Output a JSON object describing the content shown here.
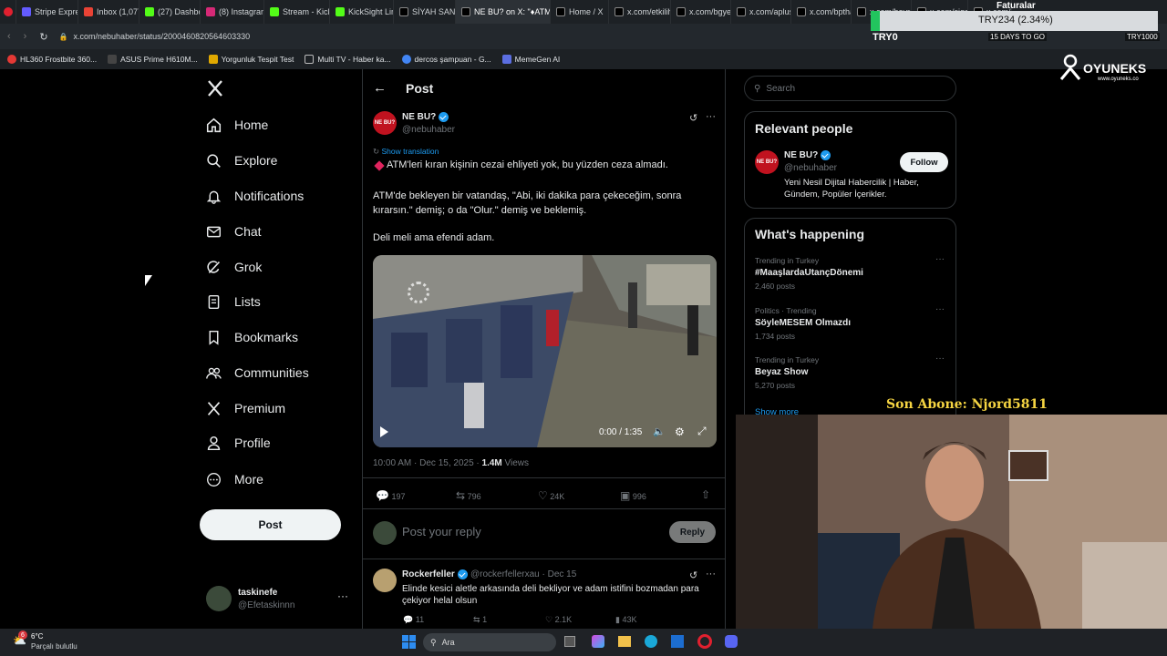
{
  "browser": {
    "tabs": [
      "Stripe Express",
      "Inbox (1,077)",
      "(27) Dashbo",
      "(8) Instagram",
      "Stream - Kick",
      "KickSight Link",
      "SİYAH SANCA",
      "NE BU? on X: \"♦ATM",
      "Home / X",
      "x.com/etkilih",
      "x.com/bgyeti",
      "x.com/aplusr",
      "x.com/bpthal",
      "x.com/hayra",
      "x.com/sigas",
      "x.com/ibrahi"
    ],
    "url": "x.com/nebuhaber/status/2000460820564603330",
    "bookmarks": [
      "HL360 Frostbite 360...",
      "ASUS Prime H610M...",
      "Yorgunluk Tespit Test",
      "Multi TV - Haber ka...",
      "dercos şampuan - G...",
      "MemeGen AI"
    ]
  },
  "overlay": {
    "faturalar": "Faturalar",
    "price": "TRY234 (2.34%)",
    "try0": "TRY0",
    "days_to_go": "15 DAYS TO GO",
    "try_small": "TRY1000",
    "brand": "OYUNEKS",
    "brand_url": "www.oyuneks.co",
    "subscriber": "Son Abone: Njord5811"
  },
  "nav": {
    "items": [
      "Home",
      "Explore",
      "Notifications",
      "Chat",
      "Grok",
      "Lists",
      "Bookmarks",
      "Communities",
      "Premium",
      "Profile",
      "More"
    ],
    "post_button": "Post",
    "account_name": "taskinefe",
    "account_handle": "@Efetaskinnn",
    "more_dots": "···"
  },
  "post": {
    "header_title": "Post",
    "author_name": "NE BU?",
    "author_handle": "@nebuhaber",
    "avatar_text": "NE BU?",
    "show_translation": "Show translation",
    "line1": "ATM'leri kıran kişinin cezai ehliyeti yok, bu yüzden ceza almadı.",
    "line2": "ATM'de bekleyen bir vatandaş, \"Abi, iki dakika para çekeceğim, sonra kırarsın.\" demiş; o da \"Olur.\" demiş ve beklemiş.",
    "line3": "Deli meli ama efendi adam.",
    "video_time": "0:00 / 1:35",
    "timestamp": "10:00 AM · Dec 15, 2025 · ",
    "views_count": "1.4M",
    "views_label": " Views",
    "replies": "197",
    "reposts": "796",
    "likes": "24K",
    "bookmarks": "996",
    "reply_placeholder": "Post your reply",
    "reply_button": "Reply"
  },
  "reply": {
    "name": "Rockerfeller",
    "meta": "@rockerfellerxau · Dec 15",
    "text": "Elinde kesici aletle arkasında deli bekliyor ve adam istifini bozmadan para çekiyor helal olsun",
    "replies": "11",
    "reposts": "1",
    "likes": "2.1K",
    "views": "43K"
  },
  "sidebar": {
    "search_placeholder": "Search",
    "relevant_title": "Relevant people",
    "person_name": "NE BU?",
    "person_handle": "@nebuhaber",
    "person_bio": "Yeni Nesil Dijital Habercilik | Haber, Gündem, Popüler İçerikler.",
    "follow_button": "Follow",
    "happening_title": "What's happening",
    "trends": [
      {
        "context": "Trending in Turkey",
        "name": "#MaaşlardaUtançDönemi",
        "posts": "2,460 posts"
      },
      {
        "context": "Politics · Trending",
        "name": "SöyleMESEM Olmazdı",
        "posts": "1,734 posts"
      },
      {
        "context": "Trending in Turkey",
        "name": "Beyaz Show",
        "posts": "5,270 posts"
      }
    ],
    "show_more": "Show more"
  },
  "taskbar": {
    "weather_temp": "6°C",
    "weather_desc": "Parçalı bulutlu",
    "badge": "6",
    "search": "Ara"
  },
  "colors": {
    "accent": "#1d9bf0",
    "brand_red": "#c0121f",
    "subscriber": "#f5d442"
  }
}
